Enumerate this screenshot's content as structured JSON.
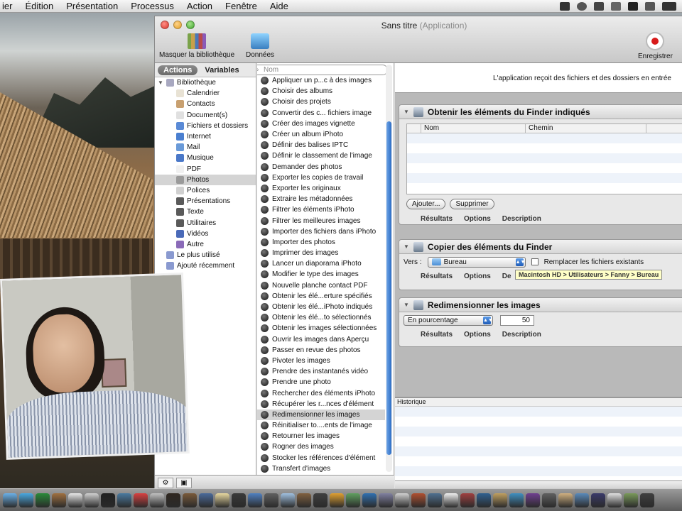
{
  "menubar": {
    "items": [
      "ier",
      "Édition",
      "Présentation",
      "Processus",
      "Action",
      "Fenêtre",
      "Aide"
    ]
  },
  "window": {
    "title": "Sans titre",
    "title_kind": "(Application)",
    "toolbar": {
      "library_button": "Masquer la bibliothèque",
      "data_button": "Données",
      "record_button": "Enregistrer"
    }
  },
  "library": {
    "tab_actions": "Actions",
    "tab_variables": "Variables",
    "search_placeholder": "Nom",
    "root": "Bibliothèque",
    "items": [
      {
        "label": "Calendrier",
        "icon": "calendar-icon",
        "color": "#e8e2d4"
      },
      {
        "label": "Contacts",
        "icon": "contacts-icon",
        "color": "#c8a070"
      },
      {
        "label": "Document(s)",
        "icon": "document-icon",
        "color": "#e0e0e0"
      },
      {
        "label": "Fichiers et dossiers",
        "icon": "finder-icon",
        "color": "#5a8ad6"
      },
      {
        "label": "Internet",
        "icon": "globe-icon",
        "color": "#4a7fd0"
      },
      {
        "label": "Mail",
        "icon": "mail-icon",
        "color": "#6a9ad8"
      },
      {
        "label": "Musique",
        "icon": "music-icon",
        "color": "#4a78c8"
      },
      {
        "label": "PDF",
        "icon": "pdf-icon",
        "color": "#f0f0f0"
      },
      {
        "label": "Photos",
        "icon": "photos-icon",
        "color": "#9a9a9a",
        "selected": true
      },
      {
        "label": "Polices",
        "icon": "fonts-icon",
        "color": "#d0d0d0"
      },
      {
        "label": "Présentations",
        "icon": "presentation-icon",
        "color": "#5a5a5a"
      },
      {
        "label": "Texte",
        "icon": "text-icon",
        "color": "#5a5a5a"
      },
      {
        "label": "Utilitaires",
        "icon": "utilities-icon",
        "color": "#5a5a5a"
      },
      {
        "label": "Vidéos",
        "icon": "video-icon",
        "color": "#4a6ab8"
      }
    ],
    "other": {
      "label": "Autre",
      "icon": "other-icon",
      "color": "#8a6ab8"
    },
    "categories": [
      {
        "label": "Le plus utilisé",
        "icon": "folder-icon",
        "color": "#8a9ad0"
      },
      {
        "label": "Ajouté récemment",
        "icon": "folder-icon",
        "color": "#8a9ad0"
      }
    ]
  },
  "actions": [
    {
      "label": "Appliquer un p...c à des images"
    },
    {
      "label": "Choisir des albums"
    },
    {
      "label": "Choisir des projets"
    },
    {
      "label": "Convertir des c... fichiers image"
    },
    {
      "label": "Créer des images vignette"
    },
    {
      "label": "Créer un album iPhoto"
    },
    {
      "label": "Définir des balises IPTC"
    },
    {
      "label": "Définir le classement de l'image"
    },
    {
      "label": "Demander des photos"
    },
    {
      "label": "Exporter les copies de travail"
    },
    {
      "label": "Exporter les originaux"
    },
    {
      "label": "Extraire les métadonnées"
    },
    {
      "label": "Filtrer les éléments iPhoto"
    },
    {
      "label": "Filtrer les meilleures images"
    },
    {
      "label": "Importer des fichiers dans iPhoto"
    },
    {
      "label": "Importer des photos"
    },
    {
      "label": "Imprimer des images"
    },
    {
      "label": "Lancer un diaporama iPhoto"
    },
    {
      "label": "Modifier le type des images"
    },
    {
      "label": "Nouvelle planche contact PDF"
    },
    {
      "label": "Obtenir les élé...erture spécifiés"
    },
    {
      "label": "Obtenir les élé...iPhoto indiqués"
    },
    {
      "label": "Obtenir les élé...to sélectionnés"
    },
    {
      "label": "Obtenir les images sélectionnées"
    },
    {
      "label": "Ouvrir les images dans Aperçu"
    },
    {
      "label": "Passer en revue des photos"
    },
    {
      "label": "Pivoter les images"
    },
    {
      "label": "Prendre des instantanés vidéo"
    },
    {
      "label": "Prendre une photo"
    },
    {
      "label": "Rechercher des éléments iPhoto"
    },
    {
      "label": "Récupérer les r...nces d'élément"
    },
    {
      "label": "Redimensionner les images",
      "selected": true
    },
    {
      "label": "Réinitialiser to....ents de l'image"
    },
    {
      "label": "Retourner les images"
    },
    {
      "label": "Rogner des images"
    },
    {
      "label": "Stocker les références d'élément"
    },
    {
      "label": "Transfert d'images"
    }
  ],
  "workflow": {
    "info": "L'application reçoit des fichiers et des dossiers en entrée",
    "tab_results": "Résultats",
    "tab_options": "Options",
    "tab_description": "Description",
    "block1": {
      "title": "Obtenir les éléments du Finder indiqués",
      "col_name": "Nom",
      "col_path": "Chemin",
      "add_button": "Ajouter...",
      "remove_button": "Supprimer"
    },
    "block2": {
      "title": "Copier des éléments du Finder",
      "to_label": "Vers :",
      "destination": "Bureau",
      "replace_label": "Remplacer les fichiers existants",
      "tooltip": "Macintosh HD > Utilisateurs > Fanny > Bureau",
      "desc_partial": "De"
    },
    "block3": {
      "title": "Redimensionner les images",
      "mode": "En pourcentage",
      "value": "50"
    },
    "history_label": "Historique"
  },
  "dock": {
    "colors": [
      "#6ab0e8",
      "#4aa8e0",
      "#2a8a3a",
      "#a07040",
      "#e8e8e8",
      "#d0d0d0",
      "#202020",
      "#4a7aa0",
      "#d84040",
      "#c0c0c0",
      "#302820",
      "#7a5a3a",
      "#4a6a9a",
      "#e8d8a0",
      "#3a3a3a",
      "#5080c0",
      "#606060",
      "#a0c0e0",
      "#806040",
      "#404040",
      "#e0a030",
      "#60a060",
      "#3070b0",
      "#8080a0",
      "#d0d0d0",
      "#b05030",
      "#507090",
      "#f0f0f0",
      "#a04040",
      "#306090",
      "#c0a060",
      "#4090c0",
      "#704090",
      "#606060",
      "#d0b080",
      "#5a8aba",
      "#3a3a6a",
      "#e0e0e0",
      "#7a9a5a",
      "#404040"
    ]
  }
}
